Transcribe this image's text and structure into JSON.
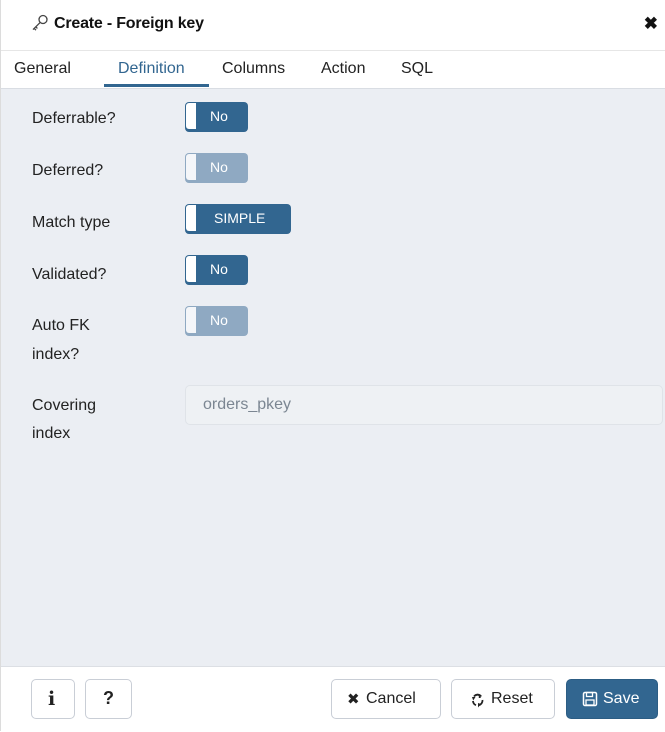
{
  "dialog": {
    "title": "Create - Foreign key",
    "close_glyph": "✖",
    "icon": "key-icon"
  },
  "tabs": [
    {
      "label": "General"
    },
    {
      "label": "Definition",
      "active": true
    },
    {
      "label": "Columns"
    },
    {
      "label": "Action"
    },
    {
      "label": "SQL"
    }
  ],
  "fields": {
    "deferrable": {
      "label": "Deferrable?",
      "value": "No"
    },
    "deferred": {
      "label": "Deferred?",
      "value": "No",
      "disabled": true
    },
    "match_type": {
      "label": "Match type",
      "value": "SIMPLE"
    },
    "validated": {
      "label": "Validated?",
      "value": "No"
    },
    "auto_fk_index": {
      "label_line1": "Auto FK",
      "label_line2": "index?",
      "value": "No",
      "disabled": true
    },
    "covering_index": {
      "label_line1": "Covering",
      "label_line2": "index",
      "value": "orders_pkey",
      "disabled": true
    }
  },
  "footer": {
    "info_glyph": "i",
    "help_glyph": "?",
    "cancel_label": "Cancel",
    "reset_label": "Reset",
    "save_label": "Save"
  },
  "colors": {
    "primary": "#326690",
    "disabled_toggle": "#8fa9c2",
    "panel_bg": "#ebeef3"
  }
}
